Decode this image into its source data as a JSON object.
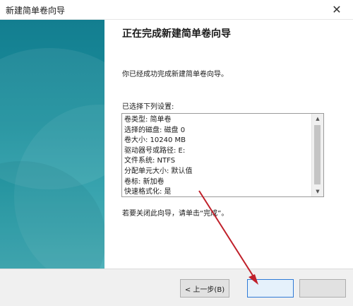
{
  "window": {
    "title": "新建简单卷向导",
    "close_glyph": "✕"
  },
  "content": {
    "heading": "正在完成新建简单卷向导",
    "intro": "你已经成功完成新建简单卷向导。",
    "selected_label": "已选择下列设置:",
    "settings": [
      "卷类型: 简单卷",
      "选择的磁盘: 磁盘 0",
      "卷大小: 10240 MB",
      "驱动器号或路径: E:",
      "文件系统: NTFS",
      "分配单元大小: 默认值",
      "卷标: 新加卷",
      "快速格式化: 是"
    ],
    "closing": "若要关闭此向导，请单击“完成”。"
  },
  "footer": {
    "back_label": "< 上一步(B)",
    "finish_label": "",
    "cancel_label": ""
  },
  "colors": {
    "banner_top": "#137e90",
    "banner_bottom": "#45adb6",
    "annotation_arrow": "#c0202a"
  },
  "icons": {
    "close": "close-icon",
    "scroll_up": "scroll-up-arrow-icon",
    "scroll_down": "scroll-down-arrow-icon"
  }
}
